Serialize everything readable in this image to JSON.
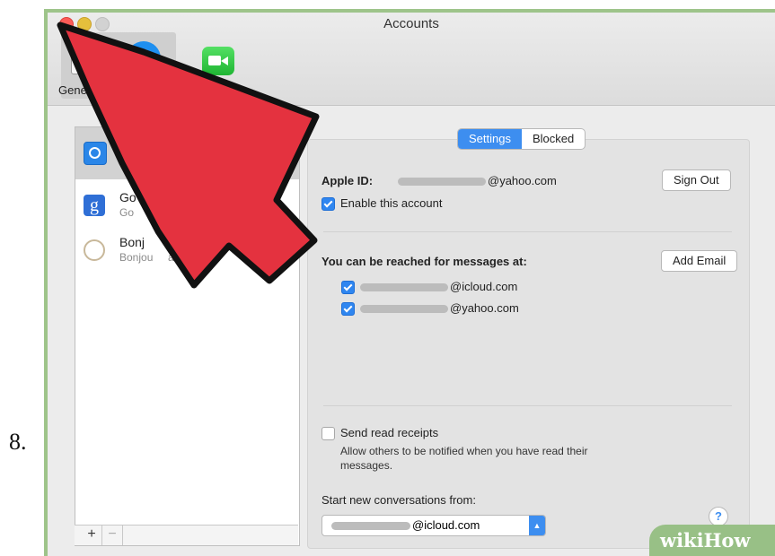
{
  "step_number": "8.",
  "window": {
    "title": "Accounts"
  },
  "toolbar": {
    "general_label": "Gene",
    "facetime_label": "ideo"
  },
  "sidebar": {
    "accounts": [
      {
        "title": "",
        "subtitle": "",
        "icon": "imessage-icon"
      },
      {
        "title": "Go",
        "subtitle": "Go",
        "icon": "google-icon"
      },
      {
        "title": "Bonj",
        "subtitle": "Bonjou     active)",
        "icon": "bonjour-icon"
      }
    ],
    "add_label": "+",
    "remove_label": "−"
  },
  "settings": {
    "tabs": {
      "settings": "Settings",
      "blocked": "Blocked"
    },
    "apple_id_label": "Apple ID:",
    "apple_id_domain": "@yahoo.com",
    "sign_out": "Sign Out",
    "enable_account": "Enable this account",
    "reach_label": "You can be reached for messages at:",
    "add_email": "Add Email",
    "addresses": [
      "@icloud.com",
      "@yahoo.com"
    ],
    "read_receipts": "Send read receipts",
    "read_receipts_desc": "Allow others to be notified when you have read their messages.",
    "start_from_label": "Start new conversations from:",
    "start_from_value": "@icloud.com",
    "help": "?"
  },
  "watermark": "wikiHow",
  "colors": {
    "arrow": "#e4323f",
    "accent": "#3d8ef0",
    "frame": "#9ec48a"
  }
}
